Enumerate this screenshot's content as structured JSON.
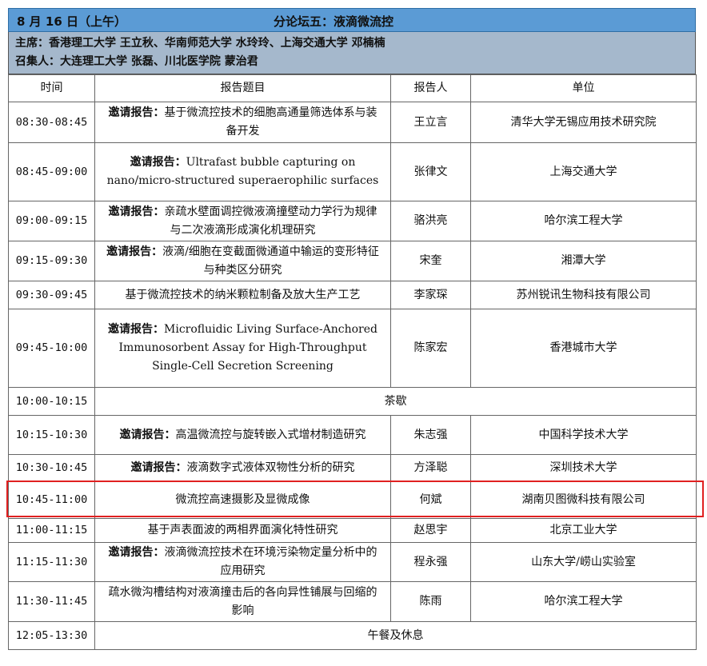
{
  "header": {
    "date": "8 月 16 日（上午）",
    "forum": "分论坛五：液滴微流控"
  },
  "chairs": {
    "chair_line": "主席：香港理工大学 王立秋、华南师范大学 水玲玲、上海交通大学 邓楠楠",
    "convener_line": "召集人：大连理工大学 张磊、川北医学院 蒙治君"
  },
  "columns": {
    "time": "时间",
    "topic": "报告题目",
    "speaker": "报告人",
    "affiliation": "单位"
  },
  "rows": [
    {
      "time": "08:30-08:45",
      "tag": "邀请报告：",
      "topic": "基于微流控技术的细胞高通量筛选体系与装备开发",
      "speaker": "王立言",
      "affiliation": "清华大学无锡应用技术研究院"
    },
    {
      "time": "08:45-09:00",
      "tag": "邀请报告：",
      "topic": "Ultrafast bubble capturing on nano/micro-structured superaerophilic surfaces",
      "speaker": "张律文",
      "affiliation": "上海交通大学"
    },
    {
      "time": "09:00-09:15",
      "tag": "邀请报告：",
      "topic": "亲疏水壁面调控微液滴撞壁动力学行为规律与二次液滴形成演化机理研究",
      "speaker": "骆洪亮",
      "affiliation": "哈尔滨工程大学"
    },
    {
      "time": "09:15-09:30",
      "tag": "邀请报告：",
      "topic": "液滴/细胞在变截面微通道中输运的变形特征与种类区分研究",
      "speaker": "宋奎",
      "affiliation": "湘潭大学"
    },
    {
      "time": "09:30-09:45",
      "tag": "",
      "topic": "基于微流控技术的纳米颗粒制备及放大生产工艺",
      "speaker": "李家琛",
      "affiliation": "苏州锐讯生物科技有限公司"
    },
    {
      "time": "09:45-10:00",
      "tag": "邀请报告：",
      "topic": "Microfluidic Living Surface-Anchored Immunosorbent Assay for High-Throughput Single-Cell Secretion Screening",
      "speaker": "陈家宏",
      "affiliation": "香港城市大学"
    },
    {
      "time": "10:00-10:15",
      "break": "茶歇"
    },
    {
      "time": "10:15-10:30",
      "tag": "邀请报告：",
      "topic": "高温微流控与旋转嵌入式增材制造研究",
      "speaker": "朱志强",
      "affiliation": "中国科学技术大学"
    },
    {
      "time": "10:30-10:45",
      "tag": "邀请报告：",
      "topic": "液滴数字式液体双物性分析的研究",
      "speaker": "方泽聪",
      "affiliation": "深圳技术大学"
    },
    {
      "time": "10:45-11:00",
      "tag": "",
      "topic": "微流控高速摄影及显微成像",
      "speaker": "何斌",
      "affiliation": "湖南贝图微科技有限公司"
    },
    {
      "time": "11:00-11:15",
      "tag": "",
      "topic": "基于声表面波的两相界面演化特性研究",
      "speaker": "赵思宇",
      "affiliation": "北京工业大学"
    },
    {
      "time": "11:15-11:30",
      "tag": "邀请报告：",
      "topic": "液滴微流控技术在环境污染物定量分析中的应用研究",
      "speaker": "程永强",
      "affiliation": "山东大学/崂山实验室"
    },
    {
      "time": "11:30-11:45",
      "tag": "",
      "topic": "疏水微沟槽结构对液滴撞击后的各向异性铺展与回缩的影响",
      "speaker": "陈雨",
      "affiliation": "哈尔滨工程大学"
    },
    {
      "time": "12:05-13:30",
      "break": "午餐及休息"
    }
  ],
  "colors": {
    "title_bg": "#5b9bd5",
    "chairs_bg": "#a5b8cc",
    "highlight": "#e02020"
  }
}
